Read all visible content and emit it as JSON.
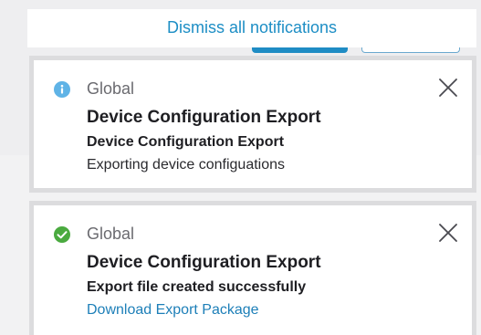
{
  "header": {
    "dismiss_all_label": "Dismiss all notifications"
  },
  "notifications": [
    {
      "status": "info",
      "status_color": "#5fb3e6",
      "icon": "info-icon",
      "scope": "Global",
      "title": "Device Configuration Export",
      "subtitle": "Device Configuration Export",
      "detail": "Exporting device configuations"
    },
    {
      "status": "success",
      "status_color": "#4aaa3f",
      "icon": "check-icon",
      "scope": "Global",
      "title": "Device Configuration Export",
      "subtitle": "Export file created successfully",
      "link": "Download Export Package"
    }
  ],
  "colors": {
    "link": "#1d8ec5",
    "primary_button": "#1f8cc4"
  }
}
